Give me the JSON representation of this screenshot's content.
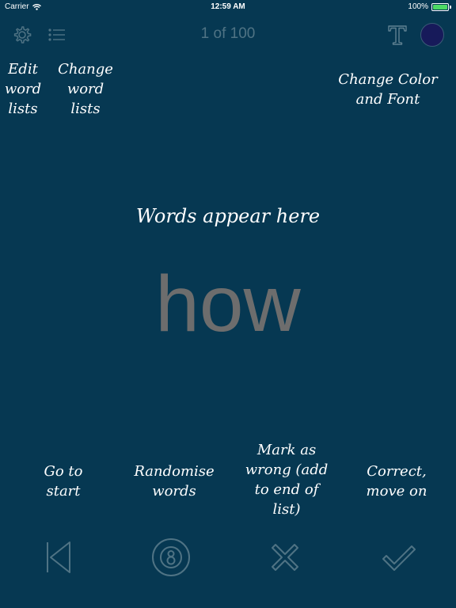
{
  "status": {
    "carrier": "Carrier",
    "time": "12:59 AM",
    "battery": "100%",
    "battery_level": 1.0
  },
  "toolbar": {
    "counter": "1 of 100",
    "font_glyph": "T",
    "selected_color": "#171a5a"
  },
  "hints": {
    "edit_word_lists": [
      "Edit",
      "word",
      "lists"
    ],
    "change_word_lists": [
      "Change",
      "word",
      "lists"
    ],
    "change_color_font": [
      "Change Color",
      "and Font"
    ],
    "words_appear": [
      "Words appear here"
    ],
    "go_to_start": [
      "Go to",
      "start"
    ],
    "randomise": [
      "Randomise",
      "words"
    ],
    "mark_wrong": [
      "Mark as",
      "wrong (add",
      "to end of",
      "list)"
    ],
    "correct": [
      "Correct,",
      "move on"
    ]
  },
  "main": {
    "word": "how"
  },
  "icons": {
    "settings": "gear-icon",
    "lists": "list-icon",
    "font": "font-icon",
    "color": "color-swatch",
    "start": "skip-to-start-icon",
    "randomise": "eight-ball-icon",
    "wrong": "cross-icon",
    "correct": "checkmark-icon"
  }
}
